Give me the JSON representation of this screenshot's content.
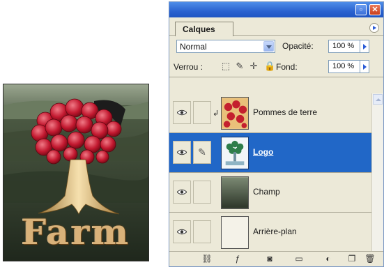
{
  "artwork": {
    "word": "Farm"
  },
  "palette": {
    "tab_label": "Calques",
    "blend_mode": "Normal",
    "opacity_label": "Opacité:",
    "opacity_value": "100 %",
    "lock_label": "Verrou :",
    "fill_label": "Fond:",
    "fill_value": "100 %",
    "layers": [
      {
        "name": "Pommes de terre",
        "selected": false
      },
      {
        "name": "Logo",
        "selected": true
      },
      {
        "name": "Champ",
        "selected": false
      },
      {
        "name": "Arrière-plan",
        "selected": false
      }
    ]
  },
  "colors": {
    "title_bar": "#2a62d0",
    "selection": "#2167c7",
    "panel_bg": "#ece9d8"
  }
}
